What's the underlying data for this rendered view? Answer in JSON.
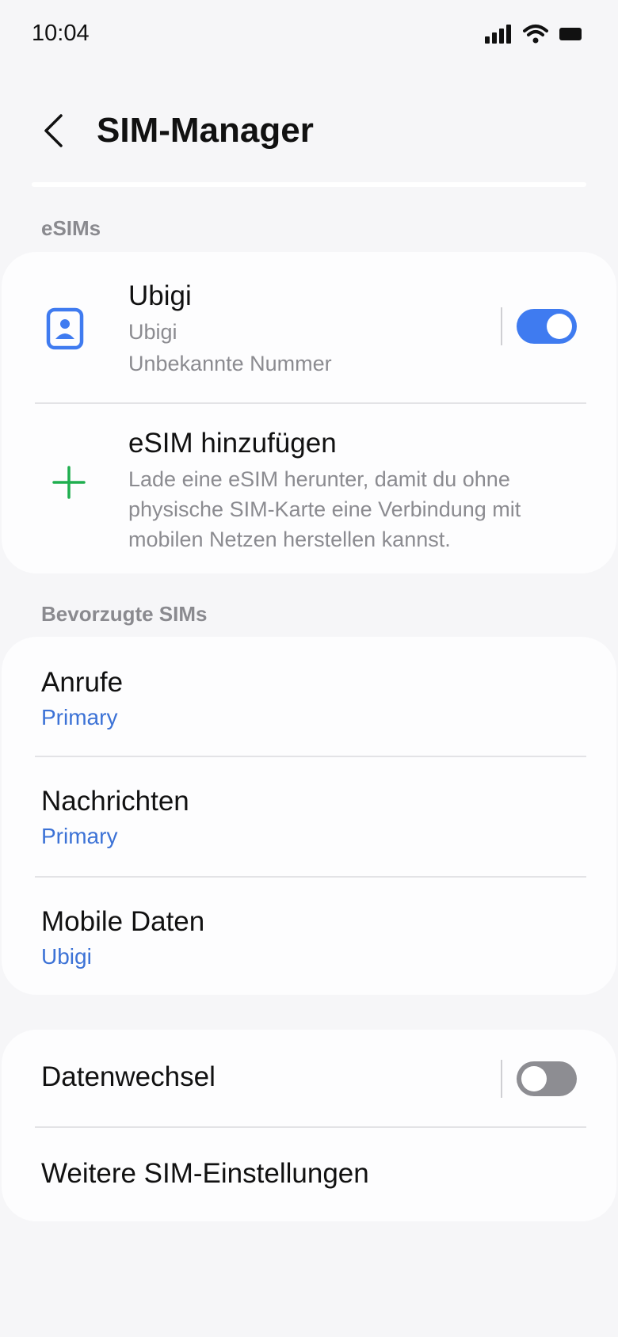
{
  "status": {
    "time": "10:04"
  },
  "header": {
    "title": "SIM-Manager"
  },
  "esims": {
    "section_label": "eSIMs",
    "sim": {
      "name": "Ubigi",
      "carrier": "Ubigi",
      "number": "Unbekannte Nummer",
      "enabled": true
    },
    "add": {
      "title": "eSIM hinzufügen",
      "desc_line1": "Lade eine eSIM herunter, damit du ohne",
      "desc_line2": "physische SIM-Karte eine Verbindung mit",
      "desc_line3": "mobilen Netzen herstellen kannst."
    }
  },
  "preferred": {
    "section_label": "Bevorzugte SIMs",
    "items": [
      {
        "label": "Anrufe",
        "value": "Primary"
      },
      {
        "label": "Nachrichten",
        "value": "Primary"
      },
      {
        "label": "Mobile Daten",
        "value": "Ubigi"
      }
    ]
  },
  "other": {
    "data_switch_label": "Datenwechsel",
    "data_switch_enabled": false,
    "more_settings_label": "Weitere SIM-Einstellungen"
  },
  "colors": {
    "accent": "#3f7bf0",
    "link": "#3c72d6",
    "add_icon": "#1fae4f"
  },
  "icons": {
    "back": "chevron-left-icon",
    "sim": "sim-card-icon",
    "add": "plus-icon",
    "signal": "signal-icon",
    "wifi": "wifi-icon",
    "battery": "battery-icon"
  }
}
